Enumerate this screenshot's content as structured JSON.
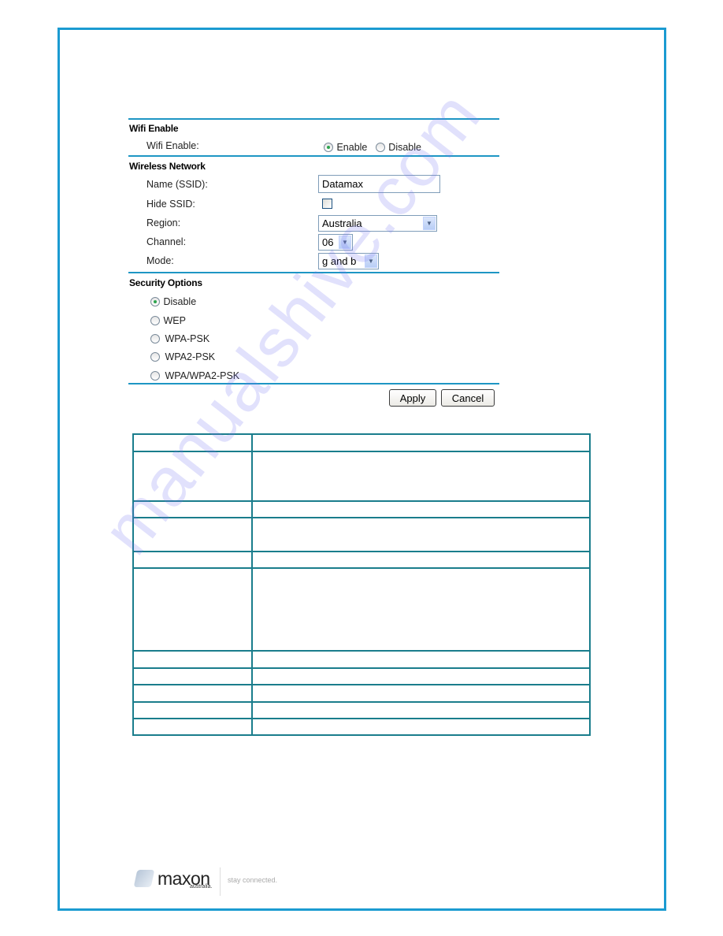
{
  "wifi_enable_section": {
    "title": "Wifi Enable",
    "field_label": "Wifi Enable:",
    "options": [
      {
        "label": "Enable",
        "checked": true
      },
      {
        "label": "Disable",
        "checked": false
      }
    ]
  },
  "wireless_network_section": {
    "title": "Wireless Network",
    "fields": {
      "ssid": {
        "label": "Name (SSID):",
        "value": "Datamax"
      },
      "hide_ssid": {
        "label": "Hide SSID:",
        "checked": false
      },
      "region": {
        "label": "Region:",
        "value": "Australia"
      },
      "channel": {
        "label": "Channel:",
        "value": "06"
      },
      "mode": {
        "label": "Mode:",
        "value": "g and b"
      }
    }
  },
  "security_section": {
    "title": "Security Options",
    "options": [
      {
        "label": "Disable",
        "checked": true
      },
      {
        "label": "WEP",
        "checked": false
      },
      {
        "label": "WPA-PSK",
        "checked": false
      },
      {
        "label": "WPA2-PSK",
        "checked": false
      },
      {
        "label": "WPA/WPA2-PSK",
        "checked": false
      }
    ]
  },
  "buttons": {
    "apply": "Apply",
    "cancel": "Cancel"
  },
  "table": {
    "rows": [
      [
        "",
        ""
      ],
      [
        "",
        ""
      ],
      [
        "",
        ""
      ],
      [
        "",
        ""
      ],
      [
        "",
        ""
      ],
      [
        "",
        ""
      ],
      [
        "",
        ""
      ],
      [
        "",
        ""
      ],
      [
        "",
        ""
      ],
      [
        "",
        ""
      ],
      [
        "",
        ""
      ]
    ]
  },
  "watermark": "manualshive.com",
  "footer": {
    "brand": "maxon",
    "brand_sub": "australia.",
    "tagline": "stay connected."
  },
  "colors": {
    "page_border": "#1b9bd1",
    "section_separator": "#1e96c4",
    "table_border": "#1a7d8c",
    "radio_checked": "#2da44e"
  }
}
